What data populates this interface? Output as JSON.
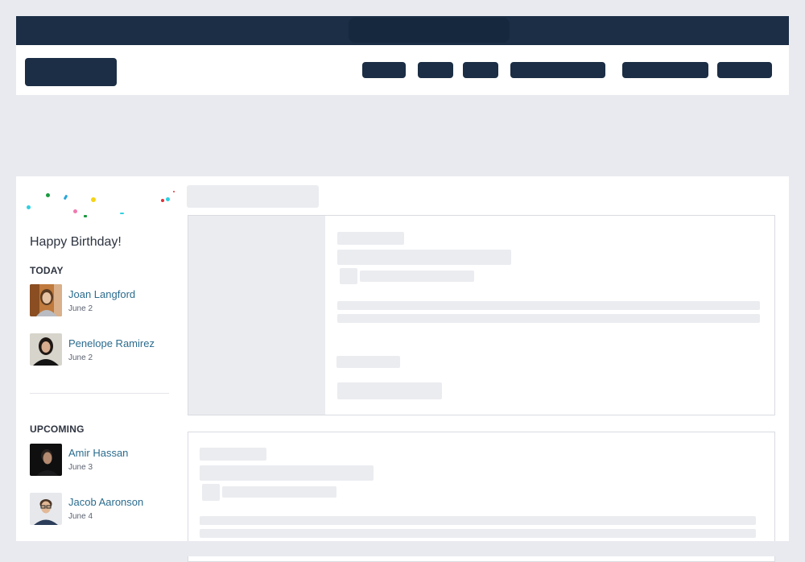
{
  "birthday_widget": {
    "title": "Happy Birthday!",
    "today_label": "TODAY",
    "upcoming_label": "UPCOMING",
    "today": [
      {
        "name": "Joan Langford",
        "date": "June 2"
      },
      {
        "name": "Penelope Ramirez",
        "date": "June 2"
      }
    ],
    "upcoming": [
      {
        "name": "Amir Hassan",
        "date": "June 3"
      },
      {
        "name": "Jacob Aaronson",
        "date": "June 4"
      }
    ]
  },
  "colors": {
    "navy": "#1b2e45",
    "link": "#2b6c8e",
    "skeleton": "#ebecf0",
    "page_background": "#e9eaf0"
  }
}
